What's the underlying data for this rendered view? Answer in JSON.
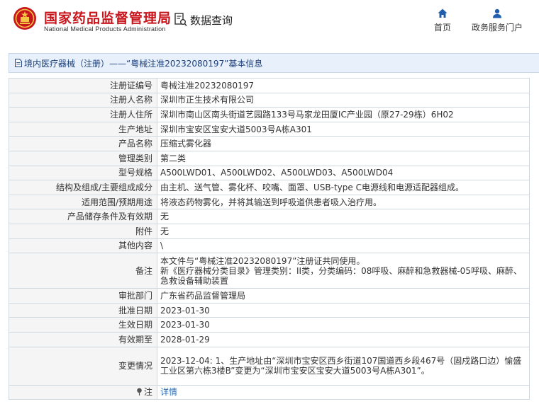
{
  "header": {
    "site_title": "国家药品监督管理局",
    "site_title_en": "National Medical Products Administration",
    "data_query": "数据查询",
    "nav_home": "首页",
    "nav_portal": "政务服务门户",
    "brand_color": "#c8161d"
  },
  "title_bar": {
    "text": "境内医疗器械（注册）——“粤械注准20232080197”基本信息"
  },
  "rows": [
    {
      "label": "注册证编号",
      "value": "粤械注准20232080197"
    },
    {
      "label": "注册人名称",
      "value": "深圳市正生技术有限公司"
    },
    {
      "label": "注册人住所",
      "value": "深圳市南山区南头街道艺园路133号马家龙田厦IC产业园（原27-29栋）6H02"
    },
    {
      "label": "生产地址",
      "value": "深圳市宝安区宝安大道5003号A栋A301"
    },
    {
      "label": "产品名称",
      "value": "压缩式雾化器"
    },
    {
      "label": "管理类别",
      "value": "第二类"
    },
    {
      "label": "型号规格",
      "value": "A500LWD01、A500LWD02、A500LWD03、A500LWD04"
    },
    {
      "label": "结构及组成/主要组成成分",
      "value": "由主机、送气管、雾化杯、咬嘴、面罩、USB-type C电源线和电源适配器组成。"
    },
    {
      "label": "适用范围/预期用途",
      "value": "将液态药物雾化，并将其输送到呼吸道供患者吸入治疗用。"
    },
    {
      "label": "产品储存条件及有效期",
      "value": "无"
    },
    {
      "label": "附件",
      "value": "无"
    },
    {
      "label": "其他内容",
      "value": "\\"
    }
  ],
  "remark": {
    "label": "备注",
    "line1": "本文件与“粤械注准20232080197”注册证共同使用。",
    "line2": "新《医疗器械分类目录》管理类别：II类，分类编码：08呼吸、麻醉和急救器械-05呼吸、麻醉、",
    "line3": "急救设备辅助装置"
  },
  "rows2": [
    {
      "label": "审批部门",
      "value": "广东省药品监督管理局"
    },
    {
      "label": "批准日期",
      "value": "2023-01-30"
    },
    {
      "label": "生效日期",
      "value": "2023-01-30"
    },
    {
      "label": "有效期至",
      "value": "2028-01-29"
    }
  ],
  "change": {
    "label": "变更情况",
    "line1": "2023-12-04: 1、生产地址由“深圳市宝安区西乡街道107国道西乡段467号（固戍路口边）愉盛",
    "line2": "工业区第六栋3楼B”变更为“深圳市宝安区宝安大道5003号A栋A301”。"
  },
  "note": {
    "label": "注",
    "link": "详情"
  }
}
